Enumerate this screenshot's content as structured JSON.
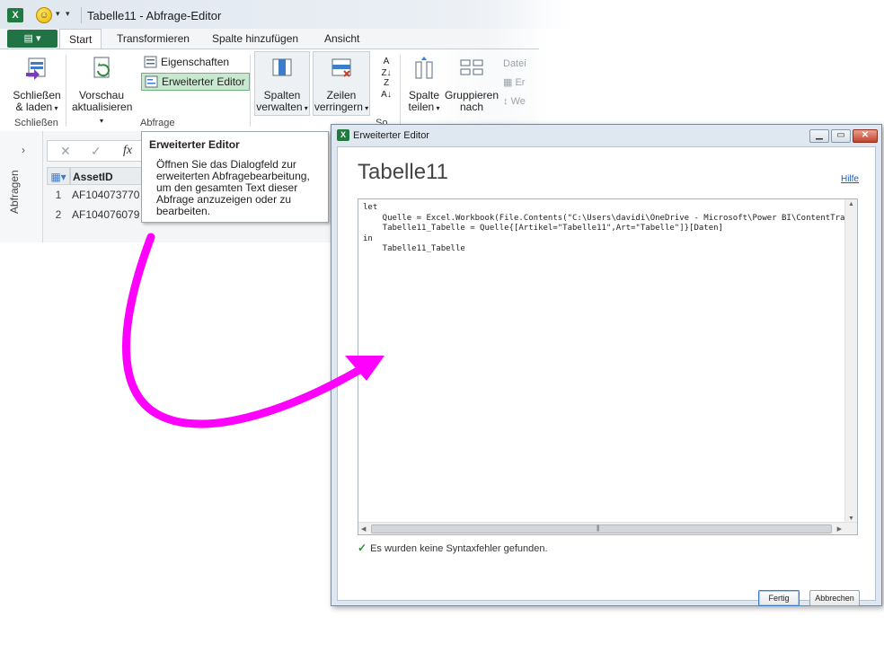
{
  "app": {
    "window_title": "Tabelle11 - Abfrage-Editor",
    "file_tab": "",
    "tabs": [
      "Start",
      "Transformieren",
      "Spalte hinzufügen",
      "Ansicht"
    ],
    "active_tab": "Start"
  },
  "ribbon": {
    "close_load": {
      "line1": "Schließen",
      "line2": "& laden"
    },
    "group_close": "Schließen",
    "refresh_preview": {
      "line1": "Vorschau",
      "line2": "aktualisieren"
    },
    "properties": "Eigenschaften",
    "advanced_editor": "Erweiterter Editor",
    "group_query": "Abfrage",
    "manage_columns": {
      "line1": "Spalten",
      "line2": "verwalten"
    },
    "reduce_rows": {
      "line1": "Zeilen",
      "line2": "verringern"
    },
    "group_sort_partial": "So",
    "split_column": {
      "line1": "Spalte",
      "line2": "teilen"
    },
    "group_by": {
      "line1": "Gruppieren",
      "line2": "nach"
    },
    "datatype_partial": "Datei",
    "replace_partial": "Er",
    "replace_values_partial": "We"
  },
  "side_pane": {
    "label": "Abfragen"
  },
  "formula_bar": {
    "cancel": "✕",
    "confirm": "✓",
    "fx": "fx"
  },
  "grid": {
    "column_header": "AssetID",
    "rows": [
      {
        "n": "1",
        "value": "AF104073770"
      },
      {
        "n": "2",
        "value": "AF104076079"
      }
    ]
  },
  "tooltip": {
    "title": "Erweiterter Editor",
    "body": "Öffnen Sie das Dialogfeld zur erweiterten Abfragebearbeitung, um den gesamten Text dieser Abfrage anzuzeigen oder zu bearbeiten."
  },
  "dialog": {
    "title": "Erweiterter Editor",
    "heading": "Tabelle11",
    "help": "Hilfe",
    "code": "let\n    Quelle = Excel.Workbook(File.Contents(\"C:\\Users\\davidi\\OneDrive - Microsoft\\Power BI\\ContentTracking\n    Tabelle11_Tabelle = Quelle{[Artikel=\"Tabelle11\",Art=\"Tabelle\"]}[Daten]\nin\n    Tabelle11_Tabelle",
    "status": "Es wurden keine Syntaxfehler gefunden.",
    "ok_button": "Fertig",
    "cancel_button": "Abbrechen"
  },
  "colors": {
    "excel_green": "#217346",
    "highlight": "#c9e8d0",
    "arrow_magenta": "#ff00ff",
    "link_blue": "#1f5fae",
    "check_green": "#2e8b3a"
  }
}
